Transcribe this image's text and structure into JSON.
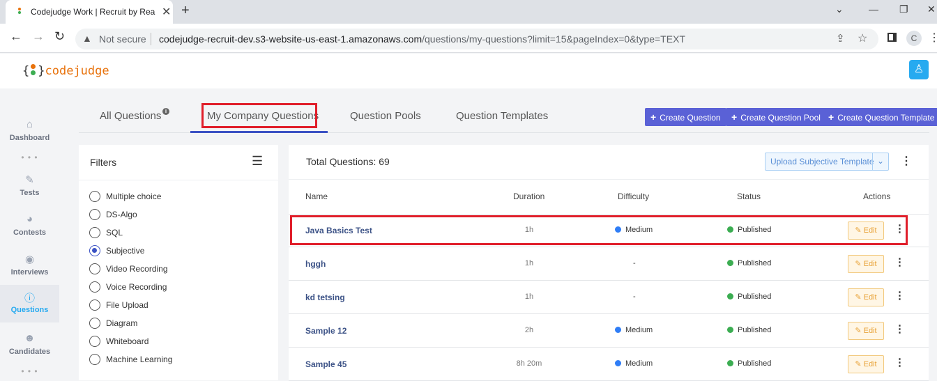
{
  "browser": {
    "tab_title": "Codejudge Work | Recruit by Rea",
    "security_label": "Not secure",
    "url_domain": "codejudge-recruit-dev.s3-website-us-east-1.amazonaws.com",
    "url_path": "/questions/my-questions?limit=15&pageIndex=0&type=TEXT",
    "profile_initial": "C"
  },
  "app": {
    "logo_text": "codejudge",
    "brand_color": "#e8720c",
    "accent_color": "#27aaf0"
  },
  "sidebar": {
    "items": [
      {
        "label": "Dashboard",
        "icon": "home-icon",
        "active": false
      },
      {
        "label": "Tests",
        "icon": "pencil-icon",
        "active": false
      },
      {
        "label": "Contests",
        "icon": "pie-chart-icon",
        "active": false
      },
      {
        "label": "Interviews",
        "icon": "podcast-icon",
        "active": false
      },
      {
        "label": "Questions",
        "icon": "question-circle-icon",
        "active": true
      },
      {
        "label": "Candidates",
        "icon": "users-icon",
        "active": false
      }
    ]
  },
  "tabs": {
    "all": "All Questions",
    "company": "My Company Questions",
    "pools": "Question Pools",
    "templates": "Question Templates",
    "active": "My Company Questions"
  },
  "actions": {
    "create_question": "Create Question",
    "create_pool": "Create Question Pool",
    "create_template": "Create Question Template"
  },
  "filters": {
    "title": "Filters",
    "options": [
      {
        "label": "Multiple choice",
        "selected": false
      },
      {
        "label": "DS-Algo",
        "selected": false
      },
      {
        "label": "SQL",
        "selected": false
      },
      {
        "label": "Subjective",
        "selected": true
      },
      {
        "label": "Video Recording",
        "selected": false
      },
      {
        "label": "Voice Recording",
        "selected": false
      },
      {
        "label": "File Upload",
        "selected": false
      },
      {
        "label": "Diagram",
        "selected": false
      },
      {
        "label": "Whiteboard",
        "selected": false
      },
      {
        "label": "Machine Learning",
        "selected": false
      }
    ]
  },
  "main": {
    "total": "Total Questions: 69",
    "upload_label": "Upload Subjective Template",
    "columns": {
      "name": "Name",
      "duration": "Duration",
      "difficulty": "Difficulty",
      "status": "Status",
      "actions": "Actions"
    },
    "edit_label": "Edit",
    "rows": [
      {
        "name": "Java Basics Test",
        "duration": "1h",
        "difficulty": "Medium",
        "status": "Published"
      },
      {
        "name": "hggh",
        "duration": "1h",
        "difficulty": "-",
        "status": "Published"
      },
      {
        "name": "kd tetsing",
        "duration": "1h",
        "difficulty": "-",
        "status": "Published"
      },
      {
        "name": "Sample 12",
        "duration": "2h",
        "difficulty": "Medium",
        "status": "Published"
      },
      {
        "name": "Sample 45",
        "duration": "8h 20m",
        "difficulty": "Medium",
        "status": "Published"
      }
    ],
    "difficulty_color": "#2f7df6",
    "status_color": "#3cad52"
  }
}
